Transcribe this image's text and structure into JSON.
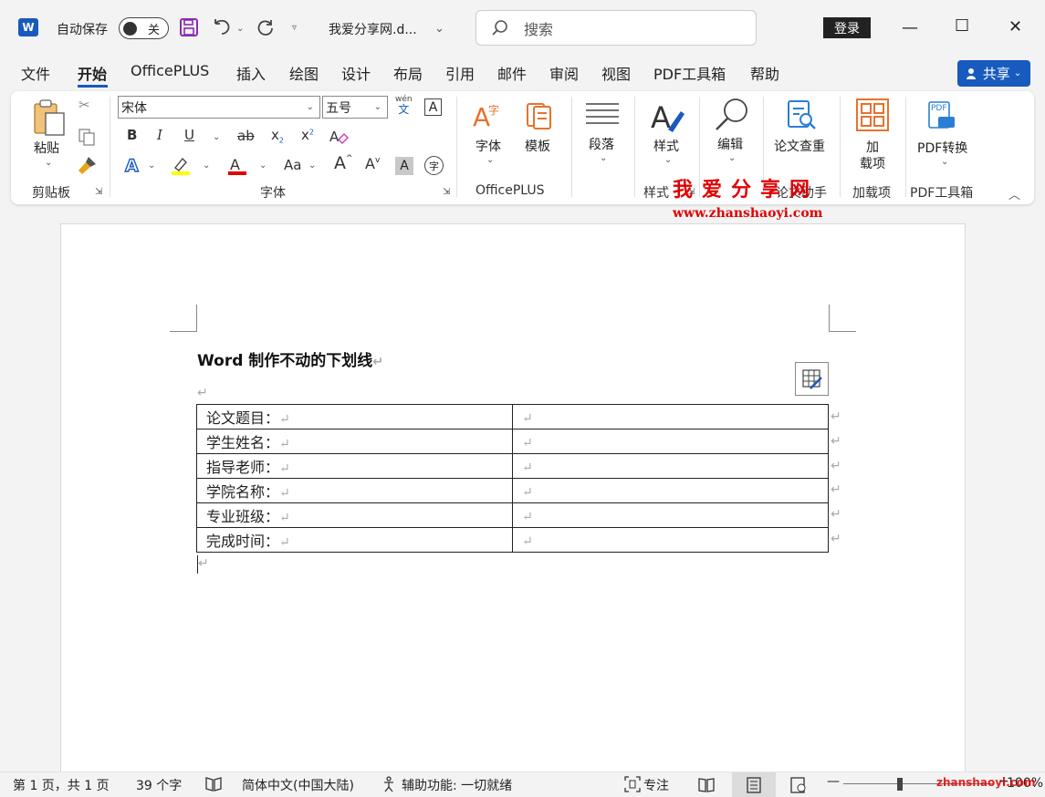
{
  "titlebar": {
    "autosave_label": "自动保存",
    "autosave_state": "关",
    "doc_title": "我爱分享网.d...",
    "search_placeholder": "搜索",
    "login_label": "登录",
    "minimize_glyph": "—",
    "maximize_glyph": "☐",
    "close_glyph": "✕"
  },
  "tabs": [
    "文件",
    "开始",
    "OfficePLUS",
    "插入",
    "绘图",
    "设计",
    "布局",
    "引用",
    "邮件",
    "审阅",
    "视图",
    "PDF工具箱",
    "帮助"
  ],
  "share_label": "共享",
  "ribbon": {
    "clipboard": {
      "paste_label": "粘贴",
      "group_label": "剪贴板"
    },
    "font": {
      "font_name": "宋体",
      "font_size": "五号",
      "group_label": "字体",
      "bold": "B",
      "italic": "I",
      "underline": "U",
      "strike": "ab",
      "subscript": "x",
      "subscript_mark": "2",
      "superscript": "x",
      "superscript_mark": "2",
      "case": "Aa",
      "grow": "A",
      "shrink": "A",
      "pinyin_top": "wén",
      "pinyin_bottom": "文",
      "shade": "A",
      "enclose": "字"
    },
    "officeplus": {
      "font_label": "字体",
      "template_label": "模板",
      "group_label": "OfficePLUS"
    },
    "paragraph": {
      "label": "段落"
    },
    "styles": {
      "label": "样式",
      "group_label": "样式"
    },
    "editing": {
      "label": "编辑"
    },
    "paper": {
      "label": "论文查重",
      "group_label": "论文助手"
    },
    "addins": {
      "label_line1": "加",
      "label_line2": "载项",
      "group_label": "加载项"
    },
    "pdf": {
      "label": "PDF转换",
      "group_label": "PDF工具箱",
      "icon_text": "PDF"
    }
  },
  "watermark": {
    "cn": "我爱分享网",
    "url": "www.zhanshaoyi.com",
    "status_url": "zhanshaoyi.com"
  },
  "document": {
    "heading": "Word 制作不动的下划线",
    "para_mark": "↵",
    "rows": [
      [
        "论文题目：",
        ""
      ],
      [
        "学生姓名：",
        ""
      ],
      [
        "指导老师：",
        ""
      ],
      [
        "学院名称：",
        ""
      ],
      [
        "专业班级：",
        ""
      ],
      [
        "完成时间：",
        ""
      ]
    ]
  },
  "status": {
    "page": "第 1 页，共 1 页",
    "words": "39 个字",
    "language": "简体中文(中国大陆)",
    "accessibility": "辅助功能: 一切就绪",
    "focus": "专注",
    "zoom": "100%",
    "zoom_minus": "—",
    "zoom_plus": "+"
  },
  "colors": {
    "accent": "#185abd",
    "highlight": "#ffff00",
    "font_color": "#e00000",
    "watermark": "#e10000"
  }
}
